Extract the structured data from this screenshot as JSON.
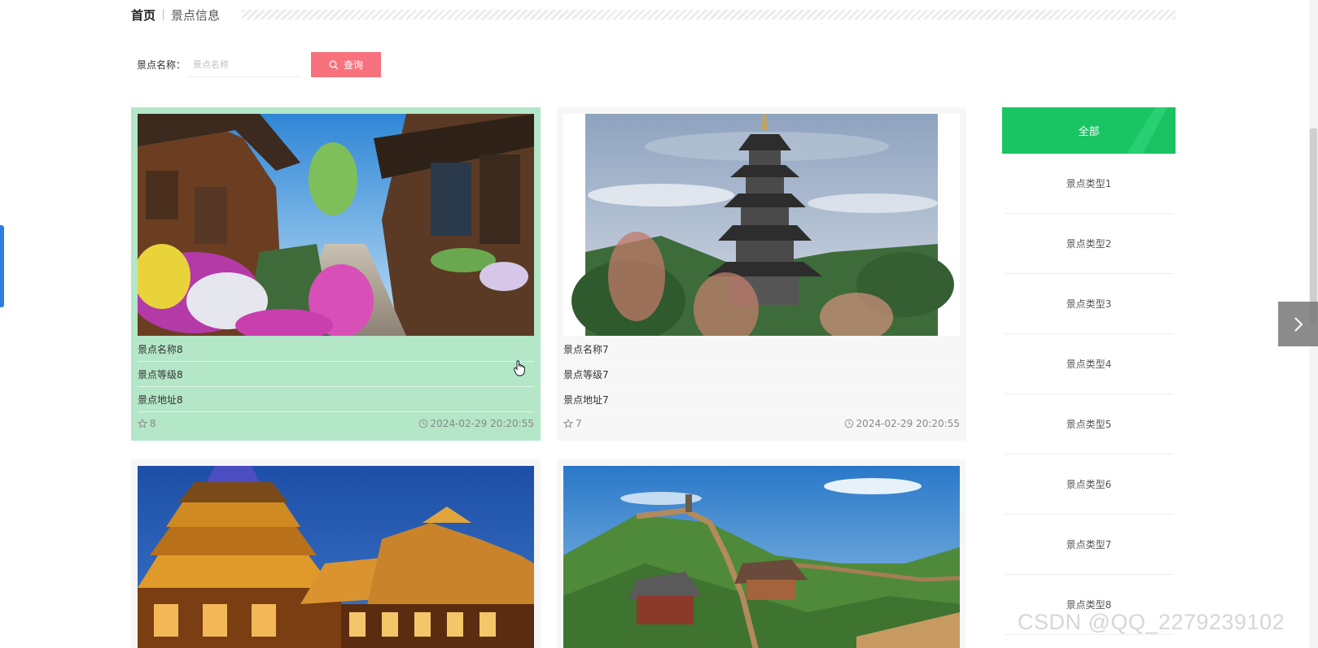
{
  "breadcrumb": {
    "home": "首页",
    "current": "景点信息"
  },
  "search": {
    "label": "景点名称：",
    "placeholder": "景点名称",
    "button_label": "查询"
  },
  "cards": [
    {
      "name": "景点名称8",
      "level": "景点等级8",
      "address": "景点地址8",
      "likes": "8",
      "time": "2024-02-29 20:20:55"
    },
    {
      "name": "景点名称7",
      "level": "景点等级7",
      "address": "景点地址7",
      "likes": "7",
      "time": "2024-02-29 20:20:55"
    }
  ],
  "sidebar": {
    "all_label": "全部",
    "items": [
      "景点类型1",
      "景点类型2",
      "景点类型3",
      "景点类型4",
      "景点类型5",
      "景点类型6",
      "景点类型7",
      "景点类型8"
    ]
  },
  "watermark": "CSDN @QQ_2279239102",
  "colors": {
    "accent_green": "#19c463",
    "search_button": "#f7727d",
    "active_card": "#b4e6c8",
    "left_tab": "#2f7de1"
  },
  "icons": [
    "search-icon",
    "star-icon",
    "clock-icon",
    "chevron-right-icon"
  ]
}
